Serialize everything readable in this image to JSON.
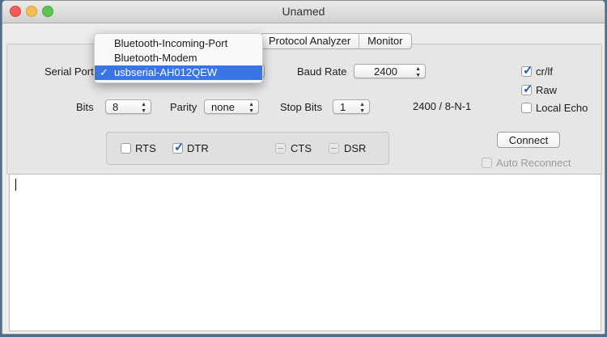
{
  "window": {
    "title": "Unamed"
  },
  "tabs": [
    {
      "label": "Protocol Analyzer"
    },
    {
      "label": "Monitor"
    }
  ],
  "serial": {
    "serial_port_label": "Serial Port",
    "baud_rate_label": "Baud Rate",
    "baud_rate_value": "2400",
    "bits_label": "Bits",
    "bits_value": "8",
    "parity_label": "Parity",
    "parity_value": "none",
    "stop_bits_label": "Stop Bits",
    "stop_bits_value": "1",
    "summary": "2400 / 8-N-1"
  },
  "options": {
    "crlf": {
      "label": "cr/lf",
      "checked": true
    },
    "raw": {
      "label": "Raw",
      "checked": true
    },
    "local_echo": {
      "label": "Local Echo",
      "checked": false
    }
  },
  "lines": {
    "rts": {
      "label": "RTS",
      "checked": false
    },
    "dtr": {
      "label": "DTR",
      "checked": true
    },
    "cts": {
      "label": "CTS",
      "enabled": false
    },
    "dsr": {
      "label": "DSR",
      "enabled": false
    }
  },
  "connect_button": "Connect",
  "auto_reconnect": {
    "label": "Auto Reconnect",
    "enabled": false
  },
  "port_menu": {
    "items": [
      {
        "label": "Bluetooth-Incoming-Port",
        "selected": false
      },
      {
        "label": "Bluetooth-Modem",
        "selected": false
      },
      {
        "label": "usbserial-AH012QEW",
        "selected": true
      }
    ],
    "selected_mark": "✓"
  },
  "colors": {
    "selection": "#3a75e5",
    "checkmark": "#1c5fb8",
    "close": "#f25b57",
    "minimize": "#f6be4f",
    "zoom": "#5dc54f"
  }
}
